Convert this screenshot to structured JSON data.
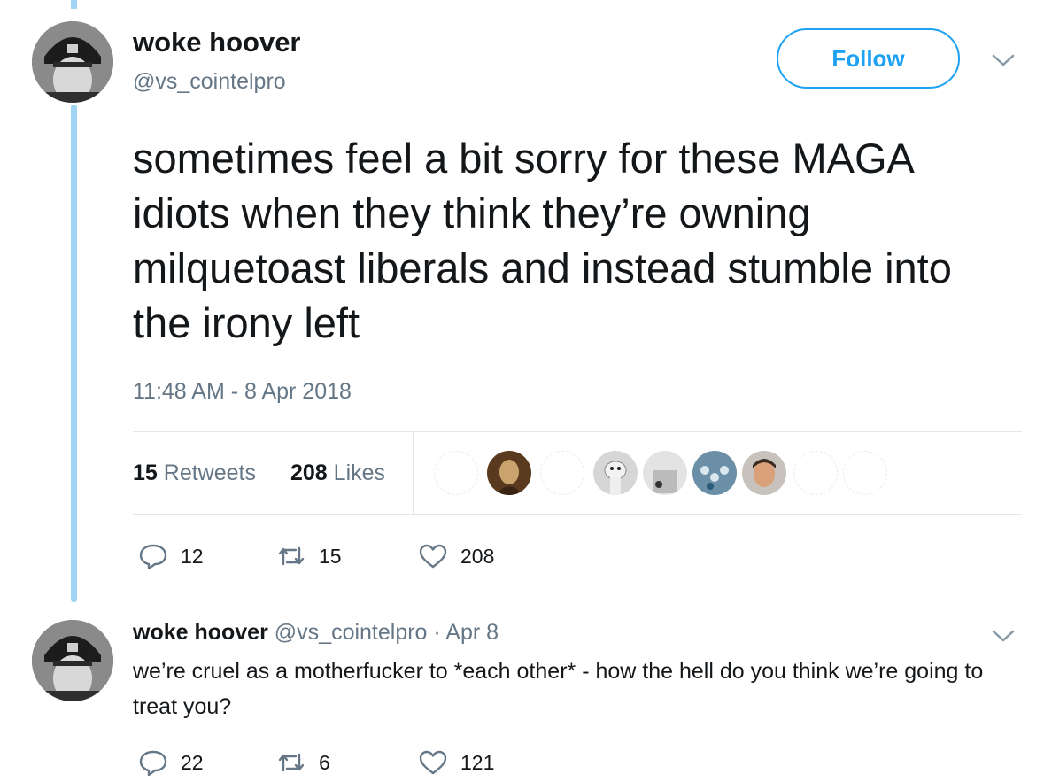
{
  "colors": {
    "accent": "#1da1f2",
    "thread_line": "#9fd4f2",
    "secondary_text": "#657786",
    "primary_text": "#14171a",
    "divider": "#e1e8ed"
  },
  "tweet": {
    "display_name": "woke hoover",
    "handle": "@vs_cointelpro",
    "follow_label": "Follow",
    "text": "sometimes feel a bit sorry for these MAGA idiots when they think they’re owning milquetoast liberals and instead stumble into the irony left",
    "timestamp": "11:48 AM - 8 Apr 2018",
    "stats": {
      "retweets_count": "15",
      "retweets_label": "Retweets",
      "likes_count": "208",
      "likes_label": "Likes"
    },
    "actions": {
      "replies": "12",
      "retweets": "15",
      "likes": "208"
    }
  },
  "reply": {
    "display_name": "woke hoover",
    "meta": "@vs_cointelpro · Apr 8",
    "text": "we’re cruel as a motherfucker to *each other* - how the hell do you think we’re going to treat you?",
    "actions": {
      "replies": "22",
      "retweets": "6",
      "likes": "121"
    }
  },
  "icons": {
    "reply": "reply-icon",
    "retweet": "retweet-icon",
    "like": "heart-icon",
    "caret": "chevron-down-icon"
  }
}
